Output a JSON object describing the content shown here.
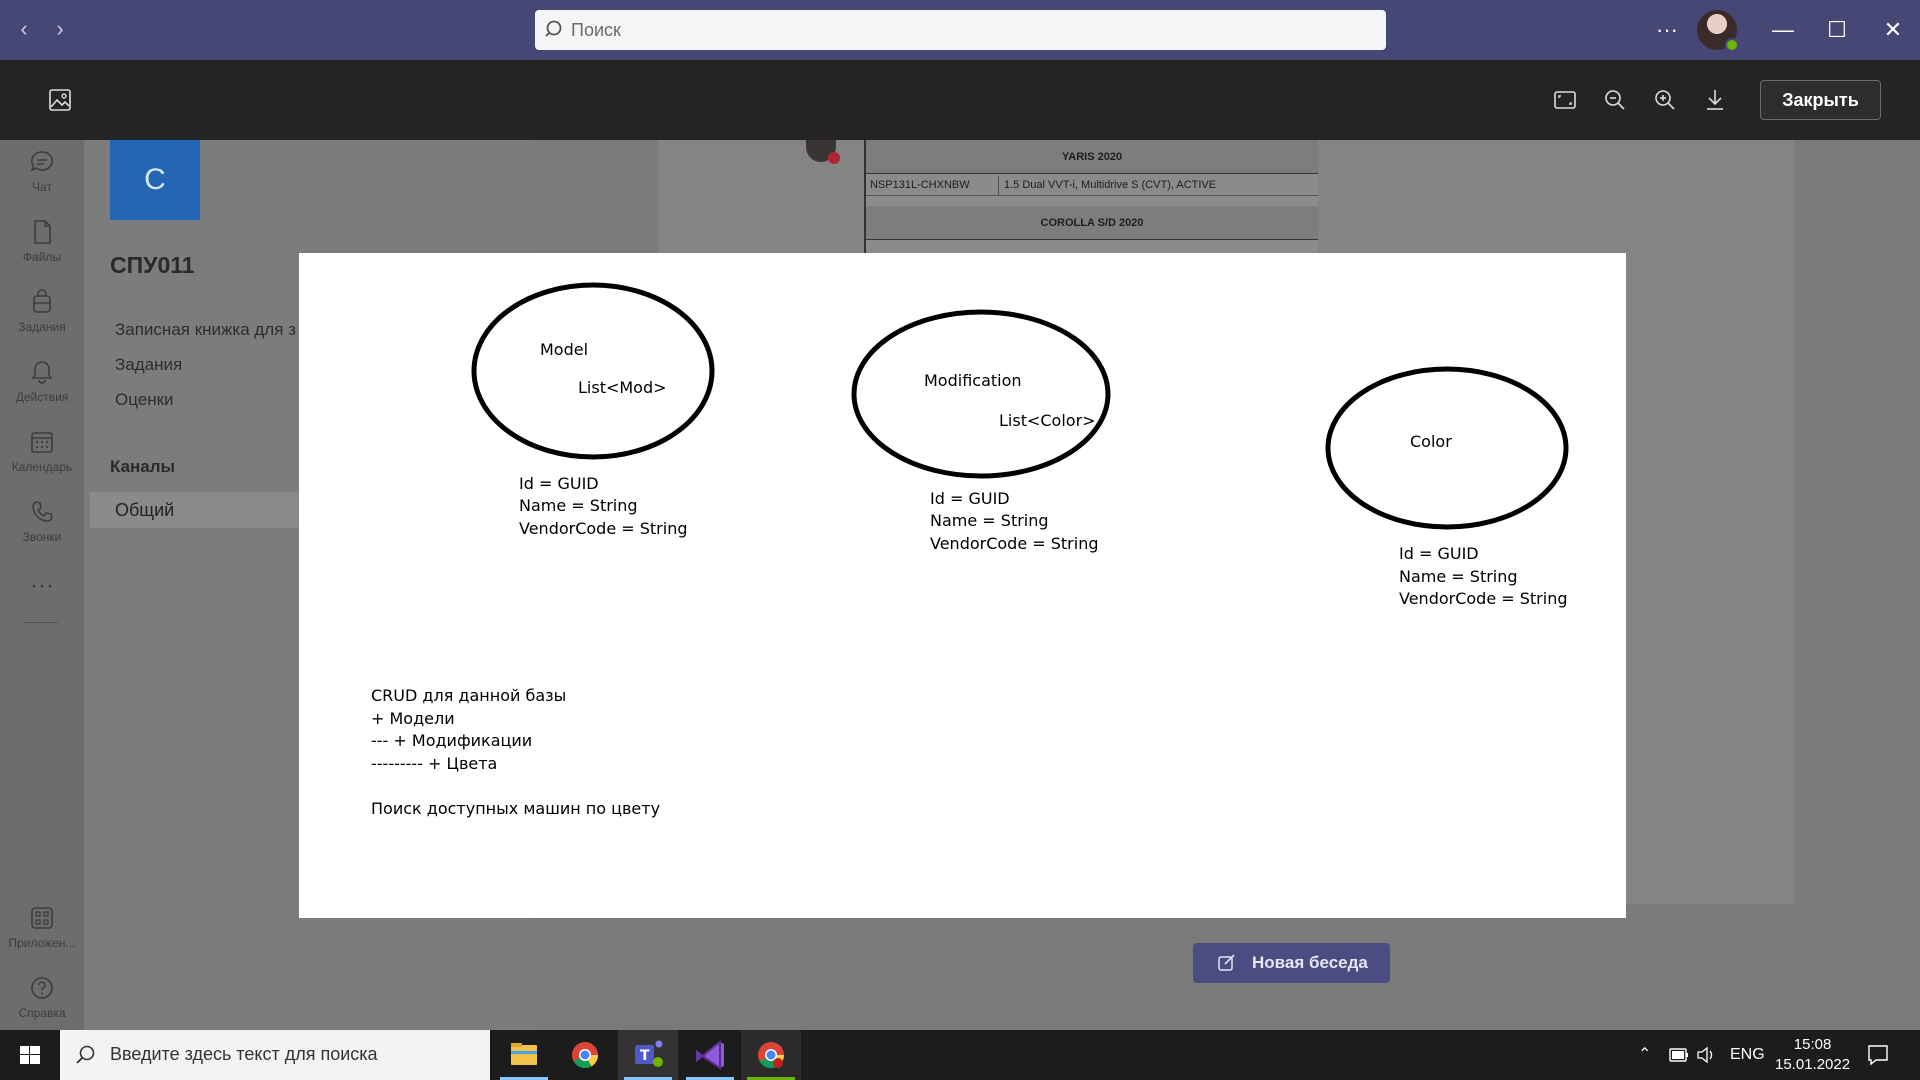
{
  "titlebar": {
    "search_placeholder": "Поиск",
    "more_label": "···"
  },
  "viewer": {
    "close_label": "Закрыть"
  },
  "rail": {
    "items": [
      {
        "label": "Чат",
        "icon": "chat-icon"
      },
      {
        "label": "Файлы",
        "icon": "files-icon"
      },
      {
        "label": "Задания",
        "icon": "assignments-icon"
      },
      {
        "label": "Действия",
        "icon": "bell-icon"
      },
      {
        "label": "Календарь",
        "icon": "calendar-icon"
      },
      {
        "label": "Звонки",
        "icon": "phone-icon"
      }
    ],
    "more": "···",
    "apps_label": "Приложен...",
    "help_label": "Справка"
  },
  "team": {
    "tile_letter": "С",
    "name": "СПУ011",
    "links": [
      "Записная книжка для з",
      "Задания",
      "Оценки"
    ],
    "channels_title": "Каналы",
    "active_channel": "Общий"
  },
  "sheet": {
    "header1": "YARIS 2020",
    "row1_code": "NSP131L-CHXNBW",
    "row1_desc": "1.5 Dual VVT-i, Multidrive S (CVT), ACTIVE",
    "header2": "COROLLA S/D 2020"
  },
  "new_convo_label": "Новая беседа",
  "diagram": {
    "entities": [
      {
        "name": "Model",
        "list": "List<Mod>",
        "fields": [
          "Id = GUID",
          "Name = String",
          "VendorCode = String"
        ]
      },
      {
        "name": "Modification",
        "list": "List<Color>",
        "fields": [
          "Id = GUID",
          "Name = String",
          "VendorCode = String"
        ]
      },
      {
        "name": "Color",
        "list": "",
        "fields": [
          "Id = GUID",
          "Name = String",
          "VendorCode = String"
        ]
      }
    ],
    "notes": [
      "CRUD для данной базы",
      "+ Модели",
      "--- + Модификации",
      "--------- + Цвета",
      "",
      "Поиск доступных машин по цвету"
    ]
  },
  "taskbar": {
    "search_placeholder": "Введите здесь текст для поиска",
    "apps": [
      "file-explorer-icon",
      "chrome-icon",
      "teams-icon",
      "visual-studio-icon",
      "chrome-profile-icon"
    ],
    "lang": "ENG",
    "time": "15:08",
    "date": "15.01.2022"
  },
  "colors": {
    "titlebar": "#464775",
    "viewer_toolbar": "#242424",
    "team_tile": "#2367b4",
    "new_convo": "#4b4c82"
  }
}
